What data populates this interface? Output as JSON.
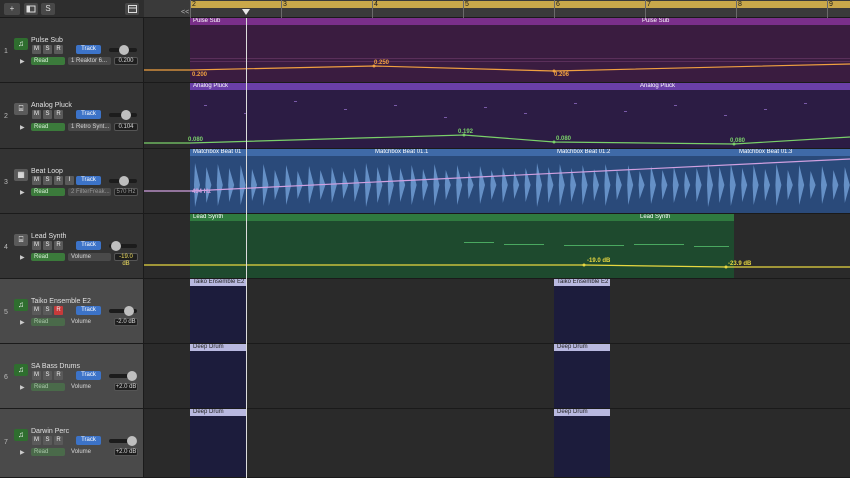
{
  "toolbar": {
    "add_label": "+",
    "s_label": "S"
  },
  "ruler": {
    "bars": [
      "2",
      "3",
      "4",
      "5",
      "6",
      "7",
      "8",
      "9"
    ],
    "left_marker": "<<"
  },
  "tracks": [
    {
      "number": "1",
      "name": "Pulse Sub",
      "mute": "M",
      "solo": "S",
      "rec": "R",
      "track_btn": "Track",
      "auto_mode": "Read",
      "auto_param": "1 Reaktor 6...",
      "auto_value": "0.200",
      "region_labels": [
        "Pulse Sub",
        "Pulse Sub"
      ],
      "auto_points": [
        "0.200",
        "0.250",
        "0.206"
      ]
    },
    {
      "number": "2",
      "name": "Analog Pluck",
      "mute": "M",
      "solo": "S",
      "rec": "R",
      "track_btn": "Track",
      "auto_mode": "Read",
      "auto_param": "1 Retro Synt...",
      "auto_value": "0.104",
      "region_labels": [
        "Analog Pluck",
        "Analog Pluck"
      ],
      "auto_points": [
        "0.080",
        "0.192",
        "0.080",
        "0.080"
      ]
    },
    {
      "number": "3",
      "name": "Beat Loop",
      "mute": "M",
      "solo": "S",
      "rec": "R",
      "input": "I",
      "track_btn": "Track",
      "auto_mode": "Read",
      "auto_param": "2 FilterFreak...",
      "auto_value": "570 Hz",
      "region_labels": [
        "Matchbox Beat 01",
        "Matchbox Beat 01.1",
        "Matchbox Beat 01.2",
        "Matchbox Beat 01.3"
      ],
      "auto_points": [
        "494 Hz"
      ]
    },
    {
      "number": "4",
      "name": "Lead Synth",
      "mute": "M",
      "solo": "S",
      "rec": "R",
      "track_btn": "Track",
      "auto_mode": "Read",
      "auto_param": "Volume",
      "auto_value": "-19.0 dB",
      "region_labels": [
        "Lead Synth",
        "Lead Synth"
      ],
      "auto_points": [
        "-19.0 dB",
        "-23.9 dB"
      ]
    },
    {
      "number": "5",
      "name": "Taiko Ensemble E2",
      "mute": "M",
      "solo": "S",
      "rec": "R",
      "track_btn": "Track",
      "auto_mode": "Read",
      "auto_param": "Volume",
      "auto_value": "-2.0 dB",
      "region_labels": [
        "Taiko Ensemble E2",
        "Taiko Ensemble E2"
      ]
    },
    {
      "number": "6",
      "name": "SA Bass Drums",
      "mute": "M",
      "solo": "S",
      "rec": "R",
      "track_btn": "Track",
      "auto_mode": "Read",
      "auto_param": "Volume",
      "auto_value": "+2.0 dB",
      "region_labels": [
        "Deep Drum",
        "Deep Drum"
      ]
    },
    {
      "number": "7",
      "name": "Darwin Perc",
      "mute": "M",
      "solo": "S",
      "rec": "R",
      "track_btn": "Track",
      "auto_mode": "Read",
      "auto_param": "Volume",
      "auto_value": "+2.0 dB",
      "region_labels": [
        "Deep Drum",
        "Deep Drum"
      ]
    }
  ],
  "colors": {
    "synth_region": "#3a1c40",
    "pluck_region": "#2c1c44",
    "beat_region": "#2a4a7a",
    "lead_region": "#1e4a2e",
    "drum_region": "#1c1c3c",
    "cycle": "#c9a84a"
  }
}
